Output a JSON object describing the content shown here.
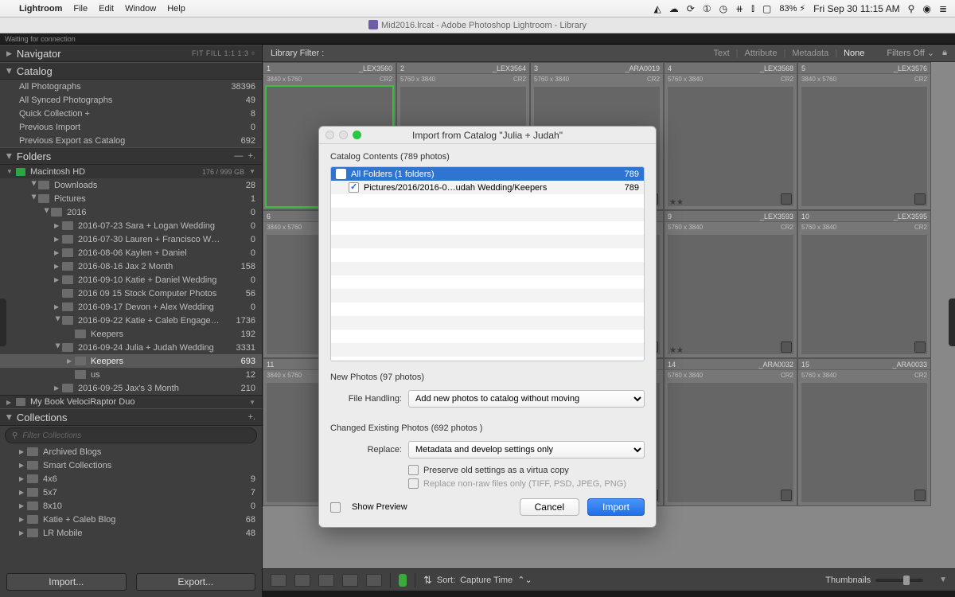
{
  "menubar": {
    "app": "Lightroom",
    "items": [
      "File",
      "Edit",
      "Window",
      "Help"
    ],
    "battery": "83%",
    "clock": "Fri Sep 30  11:15 AM"
  },
  "titlebar": {
    "text": "Mid2016.lrcat - Adobe Photoshop Lightroom - Library"
  },
  "status": {
    "text": "Waiting for connection"
  },
  "navigator": {
    "label": "Navigator",
    "tail": "FIT   FILL   1:1   1:3"
  },
  "catalog": {
    "label": "Catalog",
    "items": [
      {
        "label": "All Photographs",
        "count": "38396"
      },
      {
        "label": "All Synced Photographs",
        "count": "49"
      },
      {
        "label": "Quick Collection  +",
        "count": "8"
      },
      {
        "label": "Previous Import",
        "count": "0"
      },
      {
        "label": "Previous Export as Catalog",
        "count": "692"
      }
    ]
  },
  "folders": {
    "label": "Folders",
    "disk": {
      "name": "Macintosh HD",
      "gauge": "176 / 999 GB"
    },
    "tree": [
      {
        "ind": 2,
        "tri": "open",
        "label": "Downloads",
        "count": "28"
      },
      {
        "ind": 2,
        "tri": "open",
        "label": "Pictures",
        "count": "1"
      },
      {
        "ind": 3,
        "tri": "open",
        "label": "2016",
        "count": "0"
      },
      {
        "ind": 4,
        "tri": "▶",
        "label": "2016-07-23 Sara + Logan Wedding",
        "count": "0"
      },
      {
        "ind": 4,
        "tri": "▶",
        "label": "2016-07-30 Lauren + Francisco W…",
        "count": "0"
      },
      {
        "ind": 4,
        "tri": "▶",
        "label": "2016-08-06 Kaylen + Daniel",
        "count": "0"
      },
      {
        "ind": 4,
        "tri": "▶",
        "label": "2016-08-16 Jax 2 Month",
        "count": "158"
      },
      {
        "ind": 4,
        "tri": "▶",
        "label": "2016-09-10 Katie + Daniel Wedding",
        "count": "0"
      },
      {
        "ind": 4,
        "tri": "",
        "label": "2016 09 15 Stock Computer Photos",
        "count": "56"
      },
      {
        "ind": 4,
        "tri": "▶",
        "label": "2016-09-17 Devon + Alex Wedding",
        "count": "0"
      },
      {
        "ind": 4,
        "tri": "open",
        "label": "2016-09-22 Katie + Caleb Engage…",
        "count": "1736"
      },
      {
        "ind": 5,
        "tri": "",
        "label": "Keepers",
        "count": "192"
      },
      {
        "ind": 4,
        "tri": "open",
        "label": "2016-09-24 Julia + Judah Wedding",
        "count": "3331"
      },
      {
        "ind": 5,
        "tri": "▶",
        "label": "Keepers",
        "count": "693",
        "sel": true
      },
      {
        "ind": 5,
        "tri": "",
        "label": "us",
        "count": "12"
      },
      {
        "ind": 4,
        "tri": "▶",
        "label": "2016-09-25 Jax's 3 Month",
        "count": "210"
      }
    ],
    "disk2": {
      "name": "My Book VelociRaptor Duo"
    }
  },
  "collections": {
    "label": "Collections",
    "searchPlaceholder": "Filter Collections",
    "items": [
      {
        "label": "Archived Blogs",
        "count": ""
      },
      {
        "label": "Smart Collections",
        "count": ""
      },
      {
        "label": "4x6",
        "count": "9"
      },
      {
        "label": "5x7",
        "count": "7"
      },
      {
        "label": "8x10",
        "count": "0"
      },
      {
        "label": "Katie + Caleb Blog",
        "count": "68"
      },
      {
        "label": "LR Mobile",
        "count": "48"
      }
    ]
  },
  "bottomButtons": {
    "import": "Import...",
    "export": "Export..."
  },
  "libfilter": {
    "title": "Library Filter :",
    "tabs": [
      "Text",
      "Attribute",
      "Metadata",
      "None"
    ],
    "active": 3,
    "filtersOff": "Filters Off"
  },
  "grid": {
    "rows": [
      [
        {
          "idx": "1",
          "fn": "_LEX3560",
          "dim": "3840 x 5760",
          "fmt": "CR2",
          "cls": "dress",
          "green": true
        },
        {
          "idx": "2",
          "fn": "_LEX3564",
          "dim": "5760 x 3840",
          "fmt": "CR2"
        },
        {
          "idx": "3",
          "fn": "_ARA0019",
          "dim": "5760 x 3840",
          "fmt": "CR2"
        },
        {
          "idx": "4",
          "fn": "_LEX3568",
          "dim": "5760 x 3840",
          "fmt": "CR2",
          "cls": "door",
          "stars": "★★"
        },
        {
          "idx": "5",
          "fn": "_LEX3576",
          "dim": "3840 x 5760",
          "fmt": "CR2",
          "cls": "dress"
        }
      ],
      [
        {
          "idx": "6",
          "fn": "",
          "dim": "3840 x 5760",
          "fmt": "CR2",
          "cls": "door"
        },
        {
          "idx": "7",
          "fn": "",
          "dim": "",
          "fmt": ""
        },
        {
          "idx": "8",
          "fn": "",
          "dim": "",
          "fmt": ""
        },
        {
          "idx": "9",
          "fn": "_LEX3593",
          "dim": "5760 x 3840",
          "fmt": "CR2",
          "cls": "lace",
          "stars": "★★"
        },
        {
          "idx": "10",
          "fn": "_LEX3595",
          "dim": "5760 x 3840",
          "fmt": "CR2",
          "cls": "lace"
        }
      ],
      [
        {
          "idx": "11",
          "fn": "",
          "dim": "3840 x 5760",
          "fmt": "CR2",
          "cls": "door"
        },
        {
          "idx": "12",
          "fn": "",
          "dim": "",
          "fmt": ""
        },
        {
          "idx": "13",
          "fn": "",
          "dim": "",
          "fmt": ""
        },
        {
          "idx": "14",
          "fn": "_ARA0032",
          "dim": "5760 x 3840",
          "fmt": "CR2",
          "cls": "ring"
        },
        {
          "idx": "15",
          "fn": "_ARA0033",
          "dim": "5760 x 3840",
          "fmt": "CR2",
          "cls": "ring"
        }
      ]
    ]
  },
  "toolbar": {
    "sortLabel": "Sort:",
    "sortValue": "Capture Time",
    "thumbLabel": "Thumbnails"
  },
  "modal": {
    "title": "Import from Catalog \"Julia + Judah\"",
    "catalogContents": "Catalog Contents (789 photos)",
    "rows": [
      {
        "label": "All Folders (1 folders)",
        "count": "789",
        "sel": true,
        "chk": true
      },
      {
        "label": "Pictures/2016/2016-0…udah Wedding/Keepers",
        "count": "789",
        "sel": false,
        "chk": true,
        "sub": true
      }
    ],
    "newPhotos": "New Photos (97 photos)",
    "fileHandlingLabel": "File Handling:",
    "fileHandlingValue": "Add new photos to catalog without moving",
    "changedPhotos": "Changed Existing Photos (692 photos )",
    "replaceLabel": "Replace:",
    "replaceValue": "Metadata and develop settings only",
    "preserve": "Preserve old settings as a virtua  copy",
    "replaceNonRaw": "Replace non-raw files only (TIFF, PSD, JPEG, PNG)",
    "showPreview": "Show Preview",
    "cancel": "Cancel",
    "import": "Import"
  }
}
